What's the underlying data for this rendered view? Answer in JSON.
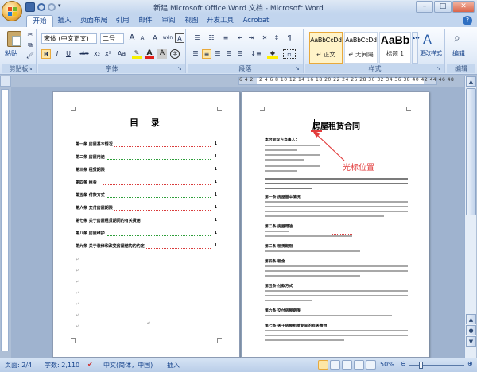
{
  "window": {
    "title": "新建 Microsoft Office Word 文档 - Microsoft Word",
    "minimize": "–",
    "maximize": "□",
    "close": "✕"
  },
  "tabs": [
    "开始",
    "插入",
    "页面布局",
    "引用",
    "邮件",
    "审阅",
    "视图",
    "开发工具",
    "Acrobat"
  ],
  "ribbon": {
    "clipboard": {
      "paste": "粘贴",
      "label": "剪贴板"
    },
    "font": {
      "name": "宋体 (中文正文)",
      "size": "二号",
      "label": "字体",
      "bold": "B",
      "italic": "I",
      "underline": "U",
      "strike": "abe",
      "sub": "x₂",
      "sup": "x²",
      "case": "Aa",
      "grow": "A",
      "shrink": "A",
      "clear": "A",
      "wen": "wén",
      "box": "A"
    },
    "paragraph": {
      "label": "段落"
    },
    "styles": {
      "label": "样式",
      "items": [
        {
          "sample": "AaBbCcDd",
          "name": "↵ 正文"
        },
        {
          "sample": "AaBbCcDd",
          "name": "↵ 无间隔"
        },
        {
          "sample": "AaBb",
          "name": "标题 1"
        }
      ],
      "change": "更改样式"
    },
    "editing": {
      "label": "编辑"
    }
  },
  "ruler": {
    "marks": "6  4  2  ·  2  4  6  8  10  12  14  16  18  20  22  24  26  28  30  32  34  36  38  40  42  44  46  48"
  },
  "page1": {
    "title": "目 录",
    "toc": [
      {
        "text": "第一条 房屋基本情况",
        "page": "1",
        "color": "#d93b3b"
      },
      {
        "text": "第二条 房屋用途",
        "page": "1",
        "color": "#2e9e3a"
      },
      {
        "text": "第三条 租赁期限",
        "page": "1",
        "color": "#d93b3b"
      },
      {
        "text": "第四条 租金",
        "page": "1",
        "color": "#d93b3b"
      },
      {
        "text": "第五条 付款方式",
        "page": "1",
        "color": "#2e9e3a"
      },
      {
        "text": "第六条 交付房屋期限",
        "page": "1",
        "color": "#d93b3b"
      },
      {
        "text": "第七条 关于房屋租赁期间的有关费用",
        "page": "1",
        "color": "#d93b3b"
      },
      {
        "text": "第八条 房屋维护",
        "page": "1",
        "color": "#2e9e3a"
      },
      {
        "text": "第九条 关于装修和改变房屋结构的约定",
        "page": "1",
        "color": "#d93b3b"
      }
    ]
  },
  "page2": {
    "title": "房屋租赁合同",
    "annotation": "光标位置",
    "clauses": [
      "本合同双方当事人：",
      "第一条 房屋基本情况",
      "第二条 房屋用途",
      "第三条 租赁期限",
      "第四条 租金",
      "第五条 付款方式",
      "第六条 交付房屋期限",
      "第七条 关于房屋租赁期间的有关费用"
    ]
  },
  "status": {
    "page": "页面: 2/4",
    "words": "字数: 2,110",
    "lang": "中文(简体，中国)",
    "mode": "插入",
    "zoom": "50%",
    "zoom_level": 0.5
  }
}
